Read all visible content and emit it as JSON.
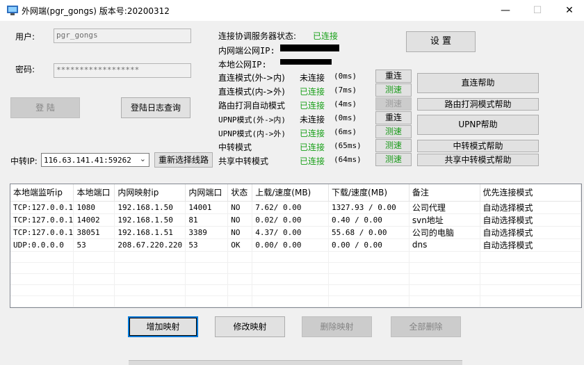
{
  "window": {
    "title": "外网端(pgr_gongs) 版本号:20200312",
    "minimize": "—",
    "maximize": "☐",
    "close": "✕"
  },
  "login": {
    "user_label": "用户:",
    "user_value": "pgr_gongs",
    "password_label": "密码:",
    "password_value": "******************",
    "login_button": "登  陆",
    "log_button": "登陆日志查询"
  },
  "relay": {
    "label": "中转IP:",
    "value": "116.63.141.41:59262",
    "reselect_button": "重新选择线路"
  },
  "status": {
    "coord_label": "连接协调服务器状态:",
    "coord_value": "已连接",
    "intranet_ip_label": "内网端公网IP:",
    "local_ip_label": "本地公网IP:",
    "settings_button": "设  置",
    "rows": [
      {
        "name": "直连模式(外->内)",
        "state": "未连接",
        "latency": "(0ms)",
        "action": "重连",
        "connected": false
      },
      {
        "name": "直连模式(内->外)",
        "state": "已连接",
        "latency": "(7ms)",
        "action": "测速",
        "connected": true
      },
      {
        "name": "路由打洞自动模式",
        "state": "已连接",
        "latency": "(4ms)",
        "action": "测速",
        "connected": true
      },
      {
        "name": "UPNP模式(外->内)",
        "state": "未连接",
        "latency": "(0ms)",
        "action": "重连",
        "connected": false
      },
      {
        "name": "UPNP模式(内->外)",
        "state": "已连接",
        "latency": "(6ms)",
        "action": "测速",
        "connected": true
      },
      {
        "name": "中转模式",
        "state": "已连接",
        "latency": "(65ms)",
        "action": "测速",
        "connected": true
      },
      {
        "name": "共享中转模式",
        "state": "已连接",
        "latency": "(64ms)",
        "action": "测速",
        "connected": true
      }
    ],
    "help_buttons": {
      "direct": "直连帮助",
      "route": "路由打洞模式帮助",
      "upnp": "UPNP帮助",
      "relay": "中转模式帮助",
      "shared": "共享中转模式帮助"
    }
  },
  "table": {
    "columns": [
      "本地端监听ip",
      "本地端口",
      "内网映射ip",
      "内网端口",
      "状态",
      "上载/速度(MB)",
      "下载/速度(MB)",
      "备注",
      "优先连接模式"
    ],
    "rows": [
      [
        "TCP:127.0.0.1",
        "1080",
        "192.168.1.50",
        "14001",
        "NO",
        "7.62/ 0.00",
        "1327.93 / 0.00",
        "公司代理",
        "自动选择模式"
      ],
      [
        "TCP:127.0.0.1",
        "14002",
        "192.168.1.50",
        "81",
        "NO",
        "0.02/ 0.00",
        "0.40 / 0.00",
        "svn地址",
        "自动选择模式"
      ],
      [
        "TCP:127.0.0.1",
        "38051",
        "192.168.1.51",
        "3389",
        "NO",
        "4.37/ 0.00",
        "55.68 / 0.00",
        "公司的电脑",
        "自动选择模式"
      ],
      [
        "UDP:0.0.0.0",
        "53",
        "208.67.220.220",
        "53",
        "OK",
        "0.00/ 0.00",
        "0.00 / 0.00",
        "dns",
        "自动选择模式"
      ]
    ]
  },
  "actions": {
    "add": "增加映射",
    "edit": "修改映射",
    "delete": "删除映射",
    "delete_all": "全部删除"
  },
  "colors": {
    "connected": "#18a018",
    "window_bg": "#f0f0f0",
    "focus_border": "#0078d7"
  }
}
